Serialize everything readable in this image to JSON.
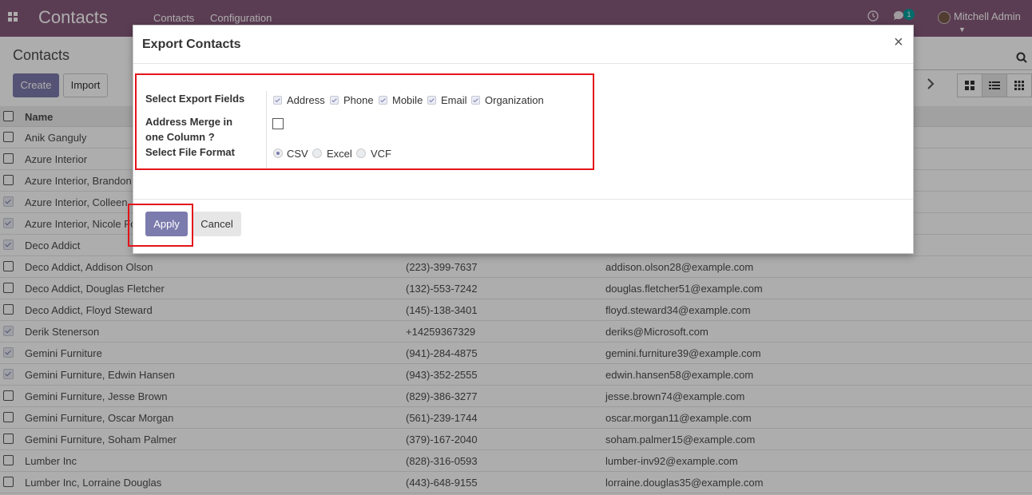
{
  "navbar": {
    "app_name": "Contacts",
    "menu": [
      "Contacts",
      "Configuration"
    ],
    "messages_count": "1",
    "user_name": "Mitchell Admin",
    "bg_color": "#875a7b"
  },
  "control_panel": {
    "breadcrumb": "Contacts",
    "create_label": "Create",
    "import_label": "Import"
  },
  "list": {
    "header_name": "Name",
    "rows": [
      {
        "name": "Anik Ganguly",
        "phone": "",
        "email": "",
        "checked": false
      },
      {
        "name": "Azure Interior",
        "phone": "",
        "email": "",
        "checked": false
      },
      {
        "name": "Azure Interior, Brandon",
        "phone": "",
        "email": "",
        "checked": false
      },
      {
        "name": "Azure Interior, Colleen",
        "phone": "",
        "email": "",
        "checked": true
      },
      {
        "name": "Azure Interior, Nicole Fo",
        "phone": "",
        "email": "",
        "checked": true
      },
      {
        "name": "Deco Addict",
        "phone": "",
        "email": "",
        "checked": true
      },
      {
        "name": "Deco Addict, Addison Olson",
        "phone": "(223)-399-7637",
        "email": "addison.olson28@example.com",
        "checked": false
      },
      {
        "name": "Deco Addict, Douglas Fletcher",
        "phone": "(132)-553-7242",
        "email": "douglas.fletcher51@example.com",
        "checked": false
      },
      {
        "name": "Deco Addict, Floyd Steward",
        "phone": "(145)-138-3401",
        "email": "floyd.steward34@example.com",
        "checked": false
      },
      {
        "name": "Derik Stenerson",
        "phone": "+14259367329",
        "email": "deriks@Microsoft.com",
        "checked": true
      },
      {
        "name": "Gemini Furniture",
        "phone": "(941)-284-4875",
        "email": "gemini.furniture39@example.com",
        "checked": true
      },
      {
        "name": "Gemini Furniture, Edwin Hansen",
        "phone": "(943)-352-2555",
        "email": "edwin.hansen58@example.com",
        "checked": true
      },
      {
        "name": "Gemini Furniture, Jesse Brown",
        "phone": "(829)-386-3277",
        "email": "jesse.brown74@example.com",
        "checked": false
      },
      {
        "name": "Gemini Furniture, Oscar Morgan",
        "phone": "(561)-239-1744",
        "email": "oscar.morgan11@example.com",
        "checked": false
      },
      {
        "name": "Gemini Furniture, Soham Palmer",
        "phone": "(379)-167-2040",
        "email": "soham.palmer15@example.com",
        "checked": false
      },
      {
        "name": "Lumber Inc",
        "phone": "(828)-316-0593",
        "email": "lumber-inv92@example.com",
        "checked": false
      },
      {
        "name": "Lumber Inc, Lorraine Douglas",
        "phone": "(443)-648-9155",
        "email": "lorraine.douglas35@example.com",
        "checked": false
      }
    ]
  },
  "modal": {
    "title": "Export Contacts",
    "close": "×",
    "labels": {
      "fields": "Select Export Fields",
      "merge": "Address Merge in one Column ?",
      "format": "Select File Format"
    },
    "fields": [
      "Address",
      "Phone",
      "Mobile",
      "Email",
      "Organization"
    ],
    "merge_checked": false,
    "formats": [
      "CSV",
      "Excel",
      "VCF"
    ],
    "selected_format": "CSV",
    "apply_label": "Apply",
    "cancel_label": "Cancel"
  },
  "colors": {
    "primary": "#7c7bad",
    "highlight": "#e3141a"
  }
}
